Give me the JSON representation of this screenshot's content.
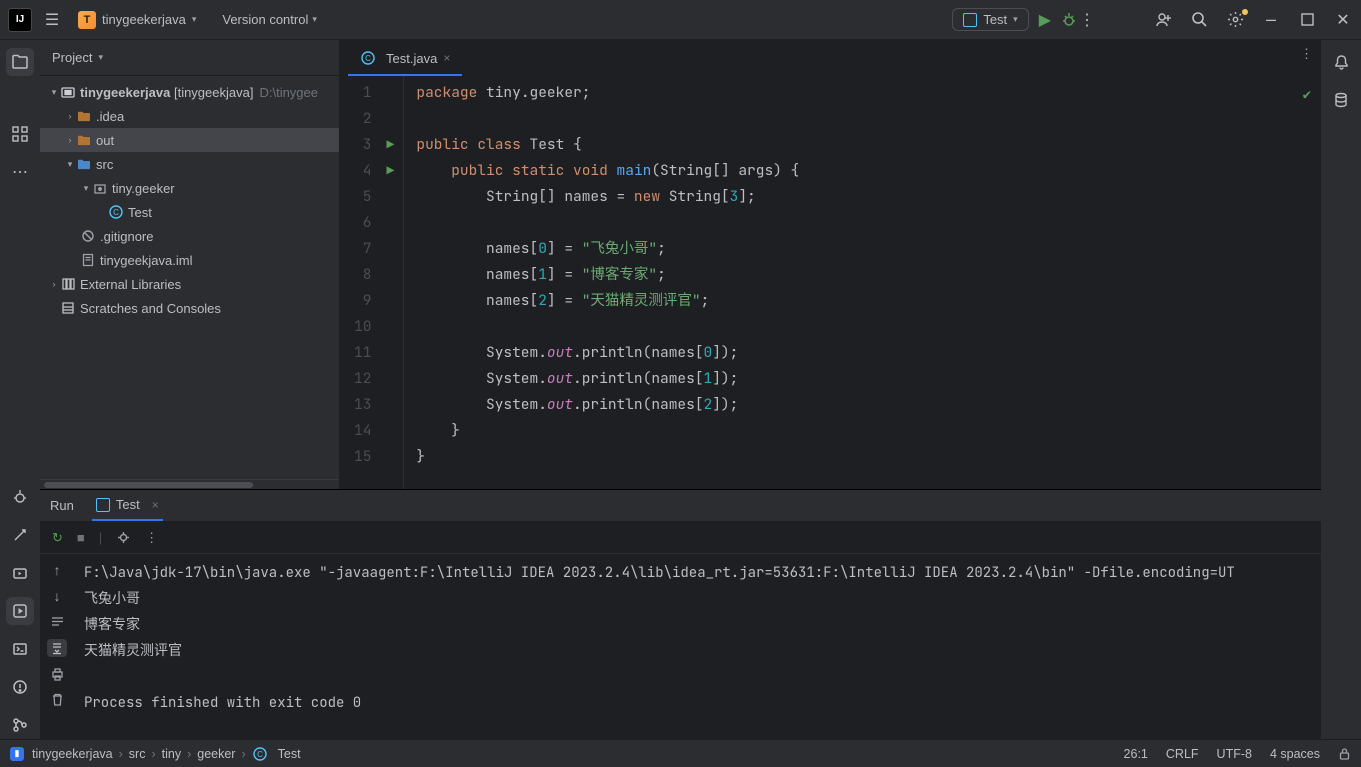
{
  "topbar": {
    "project_name": "tinygeekerjava",
    "project_letter": "T",
    "vcs_label": "Version control",
    "run_target": "Test"
  },
  "project_panel": {
    "title": "Project",
    "root_module": "tinygeekerjava",
    "root_module_alias": "[tinygeekjava]",
    "root_path": "D:\\tinygee",
    "idea_folder": ".idea",
    "out_folder": "out",
    "src_folder": "src",
    "package": "tiny.geeker",
    "class_name": "Test",
    "gitignore": ".gitignore",
    "iml": "tinygeekjava.iml",
    "ext_libs": "External Libraries",
    "scratches": "Scratches and Consoles"
  },
  "editor": {
    "tab_label": "Test.java",
    "code": {
      "package": "package",
      "pkg_name": "tiny.geeker",
      "public": "public",
      "class": "class",
      "cls_name": "Test",
      "static": "static",
      "void": "void",
      "main": "main",
      "params": "(String[] args)",
      "decl": "String[] names = ",
      "new": "new",
      "newtail": " String[",
      "size": "3",
      "close_new": "];",
      "idx0": "0",
      "idx1": "1",
      "idx2": "2",
      "v0": "\"飞兔小哥\"",
      "v1": "\"博客专家\"",
      "v2": "\"天猫精灵测评官\"",
      "out": "out",
      "println": ".println(names[",
      "println_end": "]);"
    },
    "line_numbers": [
      "1",
      "2",
      "3",
      "4",
      "5",
      "6",
      "7",
      "8",
      "9",
      "10",
      "11",
      "12",
      "13",
      "14",
      "15"
    ]
  },
  "run": {
    "title": "Run",
    "tab": "Test",
    "console": [
      "F:\\Java\\jdk-17\\bin\\java.exe \"-javaagent:F:\\IntelliJ IDEA 2023.2.4\\lib\\idea_rt.jar=53631:F:\\IntelliJ IDEA 2023.2.4\\bin\" -Dfile.encoding=UT",
      "飞兔小哥",
      "博客专家",
      "天猫精灵测评官",
      "",
      "Process finished with exit code 0"
    ]
  },
  "breadcrumbs": [
    "tinygeekerjava",
    "src",
    "tiny",
    "geeker",
    "Test"
  ],
  "status": {
    "caret": "26:1",
    "eol": "CRLF",
    "encoding": "UTF-8",
    "indent": "4 spaces"
  }
}
